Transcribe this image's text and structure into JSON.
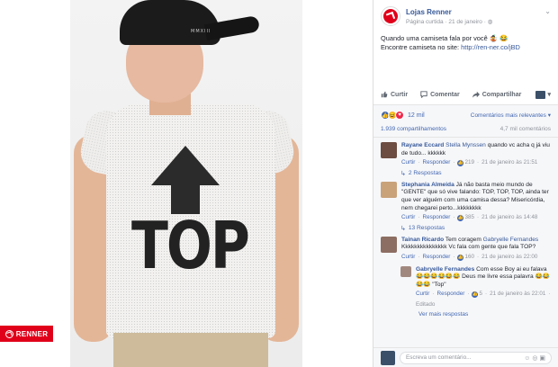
{
  "photo": {
    "cap_text": "MMXIII",
    "shirt_text": "TOP",
    "brand_badge": "RENNER"
  },
  "post": {
    "page_name": "Lojas Renner",
    "meta": "Página curtida · 21 de janeiro · ",
    "text_line1": "Quando uma camiseta fala por você 🤹 😂",
    "text_line2_prefix": "Encontre camiseta no site: ",
    "link": "http://ren-ner.co/jBD"
  },
  "actions": {
    "like": "Curtir",
    "comment": "Comentar",
    "share": "Compartilhar"
  },
  "reactions": {
    "count": "12 mil",
    "relevance": "Comentários mais relevantes ▾",
    "shares": "1.939 compartilhamentos",
    "comments_count": "4,7 mil comentários"
  },
  "comments": [
    {
      "name": "Rayane Eccard",
      "tag": "Stella Mynssen",
      "text": " quando vc acha q já viu de tudo... kkkkkk",
      "like": "Curtir",
      "reply": "Responder",
      "likes": "219",
      "time": "21 de janeiro às 21:51",
      "replies": "2 Respostas",
      "color": "#6d4c41"
    },
    {
      "name": "Stephania Almeida",
      "tag": "",
      "text": " Já não basta meio mundo de \"GENTE\" que só vive falando: TOP, TOP, TOP, ainda ter que ver alguém com uma camisa dessa? Misericórdia, nem chegarei perto...kkkkkkkk",
      "like": "Curtir",
      "reply": "Responder",
      "likes": "385",
      "time": "21 de janeiro às 14:48",
      "replies": "13 Respostas",
      "color": "#c9a27a"
    },
    {
      "name": "Tainan Ricardo",
      "tag": "Gabryelle Fernandes",
      "text_prefix": " Tem coragem ",
      "text": " Kkkkkkkkkkkkkkk Vc fala com gente que fala TOP?",
      "like": "Curtir",
      "reply": "Responder",
      "likes": "160",
      "time": "21 de janeiro às 22:00",
      "color": "#8d6e63"
    }
  ],
  "reply": {
    "name": "Gabryelle Fernandes",
    "text": " Com esse Boy ai eu falava 😂😂😂😂😂😂 Deus me livre essa palavra 😂😂😂😂 \"Top\"",
    "like": "Curtir",
    "reply": "Responder",
    "likes": "5",
    "time": "21 de janeiro às 22:01",
    "edited": "Editado",
    "color": "#a1887f"
  },
  "more_replies": "Ver mais respostas",
  "composer": {
    "placeholder": "Escreva um comentário...",
    "icons": "☺ ◎ ▣"
  },
  "colors": {
    "fb_link": "#365899",
    "brand": "#e1001a"
  }
}
